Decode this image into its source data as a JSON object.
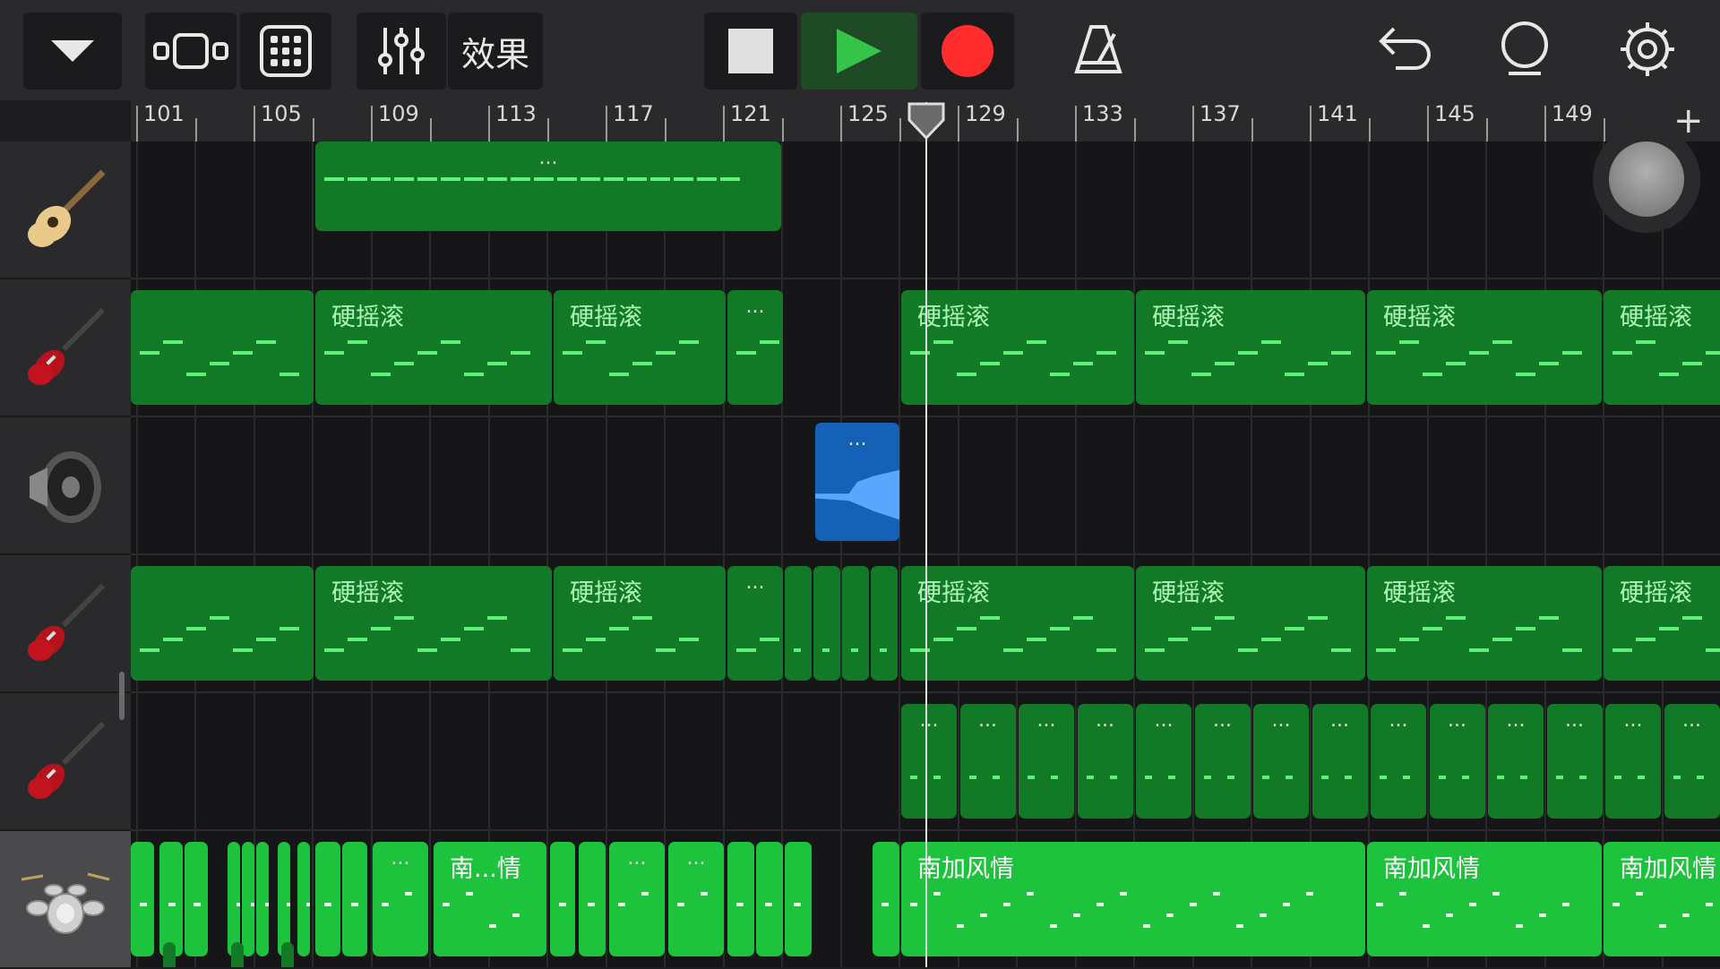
{
  "toolbar": {
    "effects_label": "效果",
    "accent_play": "#36c34a",
    "record_color": "#ff2d2d"
  },
  "ruler": {
    "labels": [
      "101",
      "105",
      "109",
      "113",
      "117",
      "121",
      "125",
      "129",
      "133",
      "137",
      "141",
      "145",
      "149"
    ],
    "add_label": "+"
  },
  "tracks": [
    {
      "name": "acoustic-guitar",
      "icon": "acoustic-guitar-icon"
    },
    {
      "name": "electric-guitar-1",
      "icon": "electric-guitar-icon"
    },
    {
      "name": "audio-recorder",
      "icon": "speaker-icon"
    },
    {
      "name": "electric-guitar-2",
      "icon": "electric-guitar-icon"
    },
    {
      "name": "electric-guitar-3",
      "icon": "electric-guitar-icon"
    },
    {
      "name": "drums",
      "icon": "drum-kit-icon"
    }
  ],
  "region_labels": {
    "hard_rock": "硬摇滚",
    "ellipsis": "...",
    "socal": "南加风情",
    "socal_short": "南...情"
  }
}
